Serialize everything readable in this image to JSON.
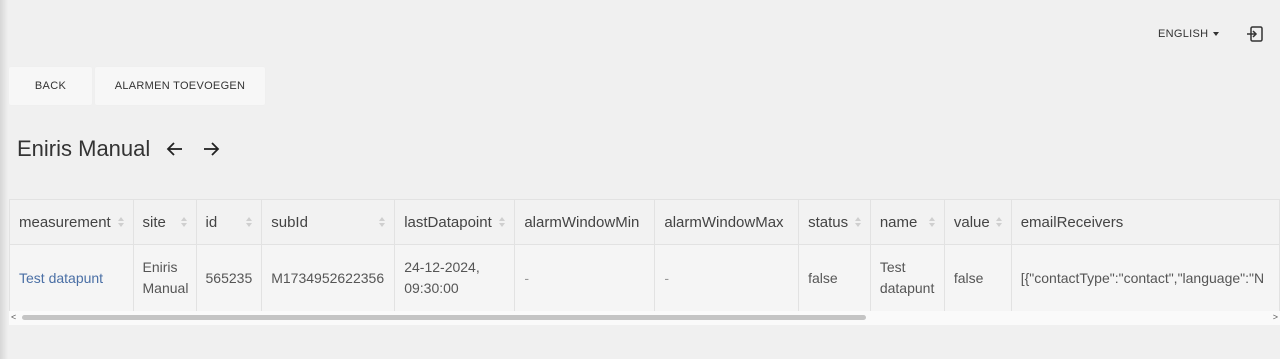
{
  "header": {
    "language_label": "ENGLISH",
    "logout_icon": "logout-icon"
  },
  "toolbar": {
    "back_label": "BACK",
    "add_alarms_label": "ALARMEN TOEVOEGEN"
  },
  "page": {
    "title": "Eniris Manual",
    "prev_icon": "arrow-left-icon",
    "next_icon": "arrow-right-icon"
  },
  "table": {
    "columns": [
      {
        "key": "measurement",
        "label": "measurement",
        "sortable": true
      },
      {
        "key": "site",
        "label": "site",
        "sortable": true
      },
      {
        "key": "id",
        "label": "id",
        "sortable": true
      },
      {
        "key": "subId",
        "label": "subId",
        "sortable": true
      },
      {
        "key": "lastDatapoint",
        "label": "lastDatapoint",
        "sortable": true
      },
      {
        "key": "alarmWindowMin",
        "label": "alarmWindowMin",
        "sortable": false
      },
      {
        "key": "alarmWindowMax",
        "label": "alarmWindowMax",
        "sortable": false
      },
      {
        "key": "status",
        "label": "status",
        "sortable": true
      },
      {
        "key": "name",
        "label": "name",
        "sortable": true
      },
      {
        "key": "value",
        "label": "value",
        "sortable": true
      },
      {
        "key": "emailReceivers",
        "label": "emailReceivers",
        "sortable": false
      }
    ],
    "rows": [
      {
        "measurement": "Test datapunt",
        "site": "Eniris Manual",
        "id": "565235",
        "subId": "M1734952622356",
        "lastDatapoint": "24-12-2024, 09:30:00",
        "alarmWindowMin": "-",
        "alarmWindowMax": "-",
        "status": "false",
        "name": "Test datapunt",
        "value": "false",
        "emailReceivers": "[{\"contactType\":\"contact\",\"language\":\"N"
      }
    ]
  },
  "scrollbar": {
    "left_glyph": "<",
    "right_glyph": ">"
  },
  "colors": {
    "background": "#f0f0f0",
    "link": "#4a6fa5",
    "button": "#f7f7f7"
  }
}
